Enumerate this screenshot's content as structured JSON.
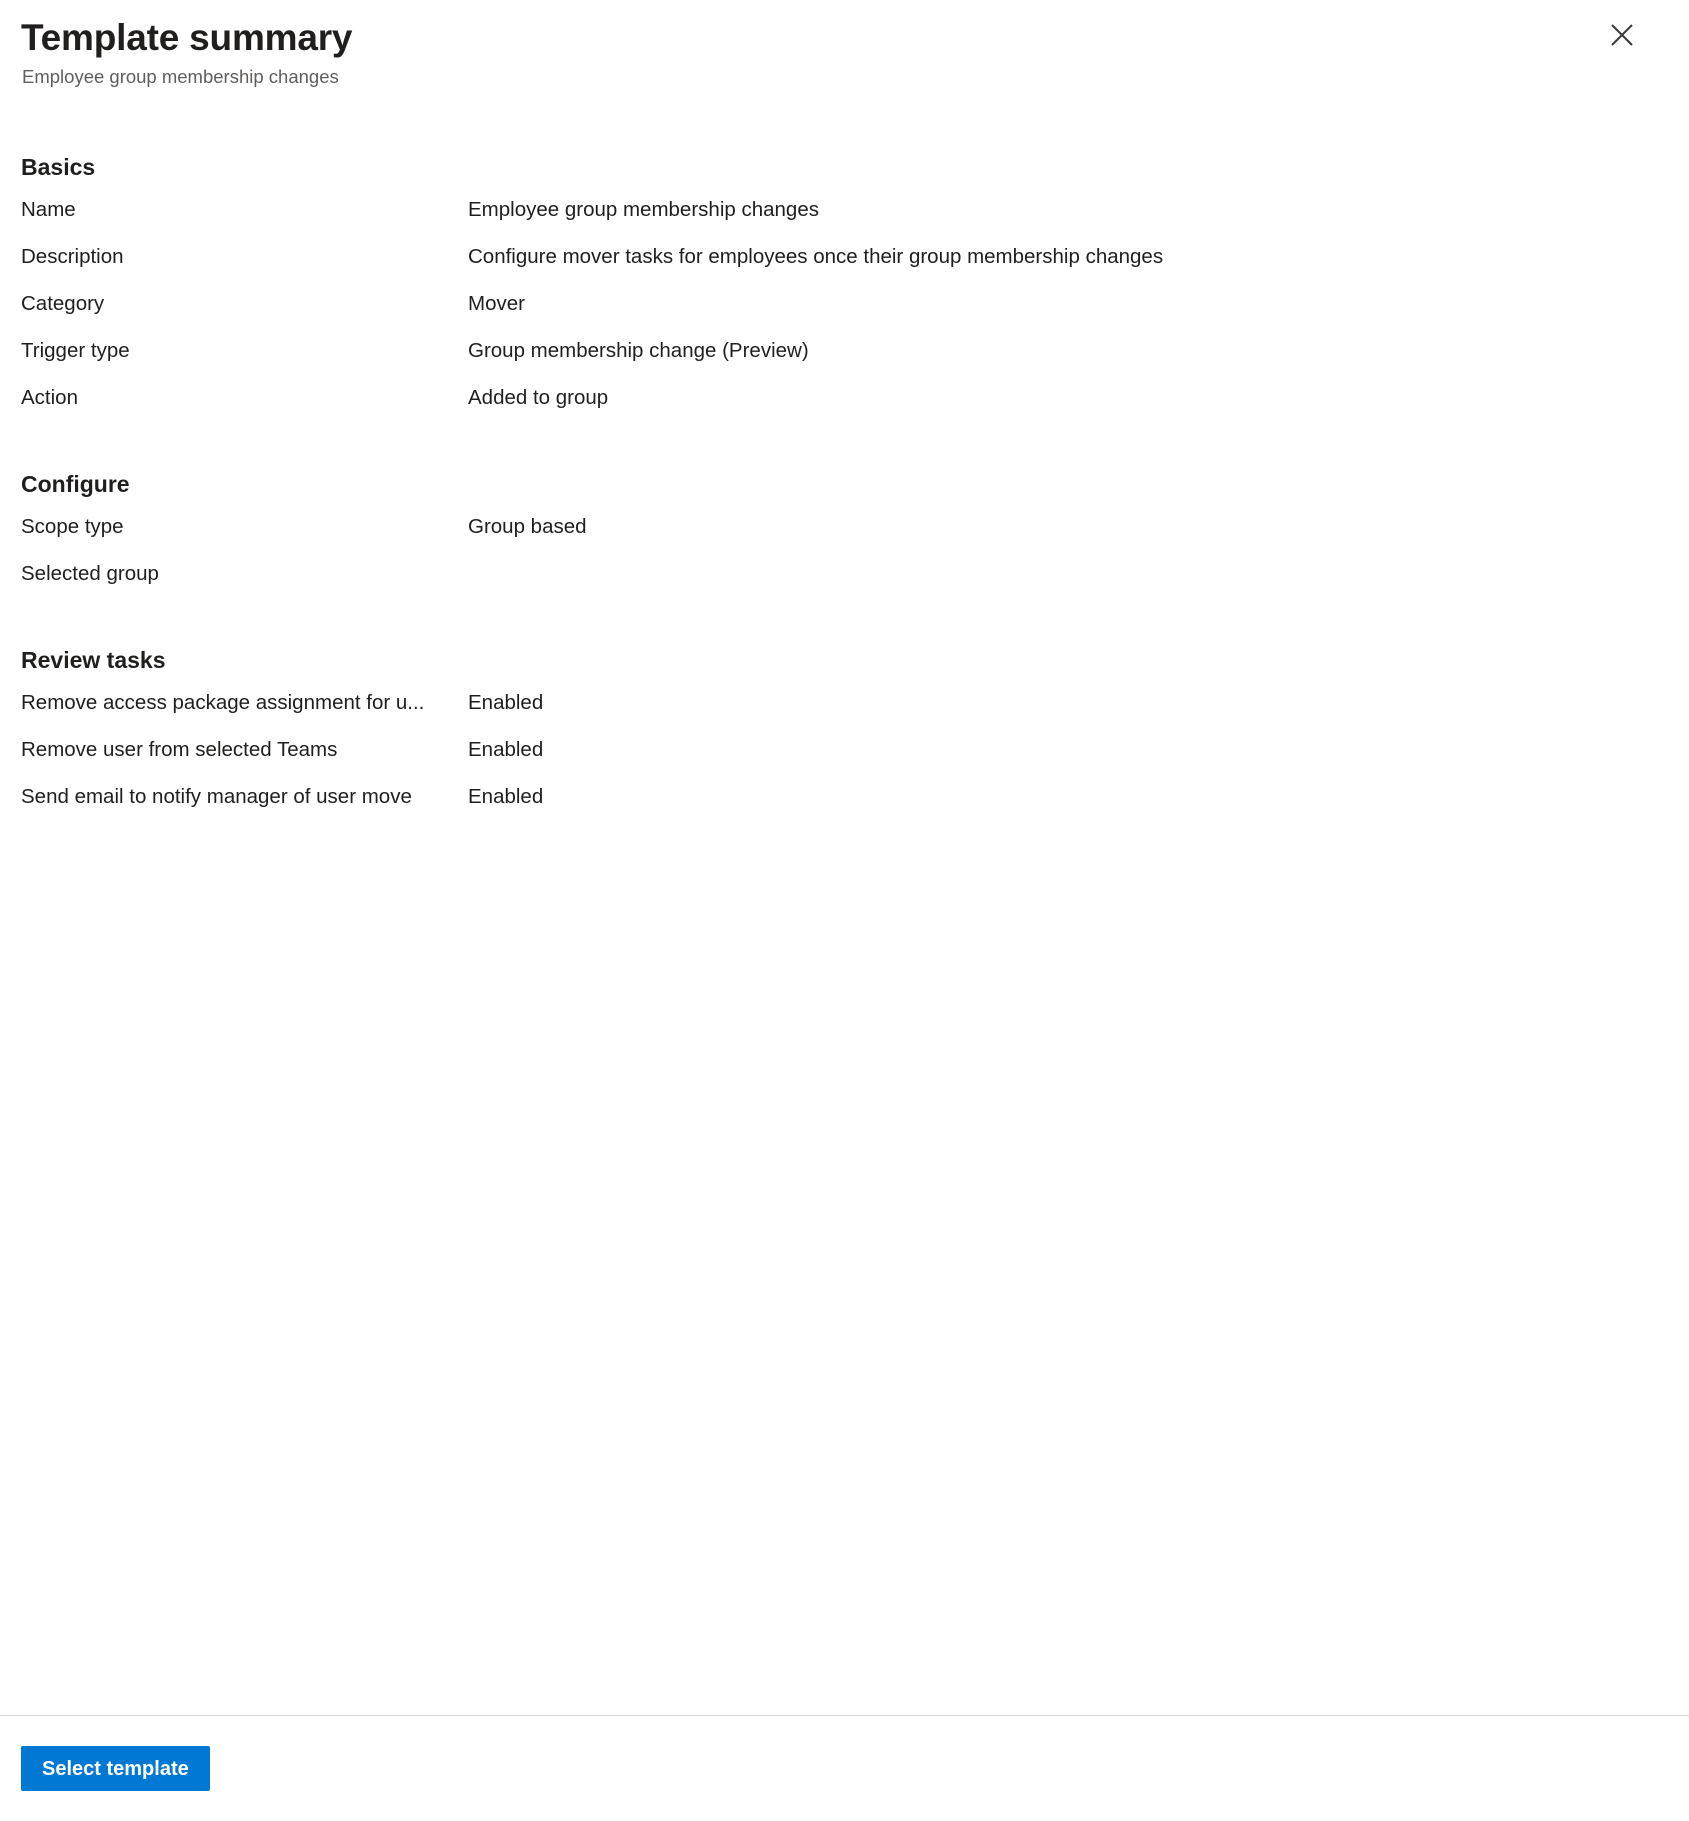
{
  "header": {
    "title": "Template summary",
    "subtitle": "Employee group membership changes",
    "close_icon": "close-icon"
  },
  "sections": [
    {
      "id": "basics",
      "title": "Basics",
      "rows": [
        {
          "label": "Name",
          "value": "Employee group membership changes"
        },
        {
          "label": "Description",
          "value": "Configure mover tasks for employees once their group membership changes"
        },
        {
          "label": "Category",
          "value": "Mover"
        },
        {
          "label": "Trigger type",
          "value": "Group membership change (Preview)"
        },
        {
          "label": "Action",
          "value": "Added to group"
        }
      ]
    },
    {
      "id": "configure",
      "title": "Configure",
      "rows": [
        {
          "label": "Scope type",
          "value": "Group based"
        },
        {
          "label": "Selected group",
          "value": ""
        }
      ]
    },
    {
      "id": "review-tasks",
      "title": "Review tasks",
      "rows": [
        {
          "label": "Remove access package assignment for u...",
          "value": "Enabled"
        },
        {
          "label": "Remove user from selected Teams",
          "value": "Enabled"
        },
        {
          "label": "Send email to notify manager of user move",
          "value": "Enabled"
        }
      ]
    }
  ],
  "footer": {
    "select_template_label": "Select template"
  },
  "colors": {
    "accent": "#0078d4",
    "text_primary": "#201f1e",
    "text_secondary": "#605e5c",
    "divider": "#d6d6d6"
  }
}
